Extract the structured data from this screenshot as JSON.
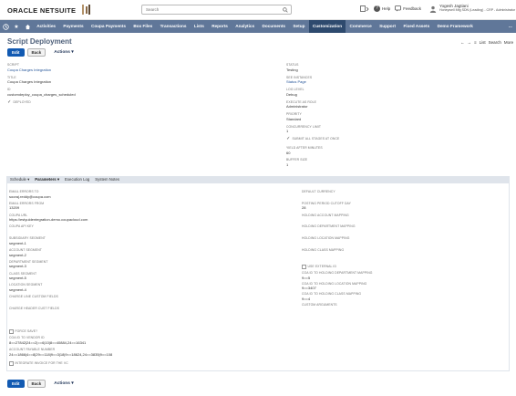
{
  "header": {
    "logo_text": "ORACLE NETSUITE",
    "search_placeholder": "Search",
    "help_label": "Help",
    "feedback_label": "Feedback",
    "user_name": "Yogesh Jagtiani",
    "user_role": "Honeywell Mfg SDN (Leading) - CRP - Administrator"
  },
  "nav": {
    "items": [
      "Activities",
      "Payments",
      "Coupa Payments",
      "Box Files",
      "Transactions",
      "Lists",
      "Reports",
      "Analytics",
      "Documents",
      "Setup",
      "Customization",
      "Commerce",
      "Support",
      "Fixed Assets",
      "Demo Framework"
    ],
    "active": "Customization",
    "more": "..."
  },
  "page": {
    "title": "Script Deployment",
    "list_label": "List",
    "search_label": "Search",
    "more_label": "More",
    "edit_label": "Edit",
    "back_label": "Back",
    "actions_label": "Actions ▾"
  },
  "primary_left": [
    {
      "label": "SCRIPT",
      "value": "Coupa Charges Integration",
      "link": true
    },
    {
      "label": "TITLE",
      "value": "Coupa Charges Integration"
    },
    {
      "label": "ID",
      "value": "customdeploy_coupa_charges_scheduled"
    }
  ],
  "deployed_label": "DEPLOYED",
  "primary_right": [
    {
      "label": "STATUS",
      "value": "Testing"
    },
    {
      "label": "SEE INSTANCES",
      "value": "Status Page",
      "link": true
    },
    {
      "label": "LOG LEVEL",
      "value": "Debug"
    },
    {
      "label": "EXECUTE AS ROLE",
      "value": "Administrator"
    },
    {
      "label": "PRIORITY",
      "value": "Standard"
    },
    {
      "label": "CONCURRENCY LIMIT",
      "value": "1"
    }
  ],
  "submit_all_label": "SUBMIT ALL STAGES AT ONCE",
  "primary_right_2": [
    {
      "label": "YIELD AFTER MINUTES",
      "value": "60"
    },
    {
      "label": "BUFFER SIZE",
      "value": "1"
    }
  ],
  "subtabs": [
    "Schedule ▾",
    "Parameters ▾",
    "Execution Log",
    "System Notes"
  ],
  "active_subtab": "Parameters ▾",
  "params_left": [
    {
      "label": "EMAIL ERRORS TO",
      "value": "sooraj.reddy@coupa.com"
    },
    {
      "label": "EMAIL ERRORS FROM",
      "value": "13209"
    },
    {
      "label": "COUPA URL",
      "value": "https://estyuldentegration-demo.coupacloud.com"
    },
    {
      "label": "COUPA API KEY",
      "value": ""
    },
    {
      "label": "SUBSIDIARY SEGMENT",
      "value": "segment-1"
    },
    {
      "label": "ACCOUNT SEGMENT",
      "value": "segment-2"
    },
    {
      "label": "DEPARTMENT SEGMENT",
      "value": "segment-3"
    },
    {
      "label": "CLASS SEGMENT",
      "value": "segment-5"
    },
    {
      "label": "LOCATION SEGMENT",
      "value": "segment-4"
    },
    {
      "label": "CHARGE LINE CUSTOM FIELDS",
      "value": ""
    },
    {
      "label": "CHARGE HEADER CUST FIELDS",
      "value": ""
    }
  ],
  "force_save_label": "FORCE SAVE?",
  "params_left_2": [
    {
      "label": "COA ID TO VENDOR ID",
      "value": "8==27842|24==2|==6|10|8==40884,24==16341"
    },
    {
      "label": "ACCOUNT PAYABLE NUMBER",
      "value": "24==1866|4==8|29==118|9==3|18|9==18624,24==3835|9==108"
    }
  ],
  "integrate_invoice_label": "INTEGRATE INVOICE FOR THE VC",
  "params_right": [
    {
      "label": "DEFAULT CURRENCY",
      "value": ""
    },
    {
      "label": "POSTING PERIOD CUTOFF DAY",
      "value": "28"
    },
    {
      "label": "HOLDING ACCOUNT MAPPING",
      "value": ""
    },
    {
      "label": "HOLDING DEPARTMENT MAPPING",
      "value": ""
    },
    {
      "label": "HOLDING LOCATION MAPPING",
      "value": ""
    },
    {
      "label": "HOLDING CLASS MAPPING",
      "value": ""
    }
  ],
  "use_external_label": "USE EXTERNAL ID",
  "params_right_2": [
    {
      "label": "COA ID TO HOLDING DEPARTMENT MAPPING",
      "value": "9==5"
    },
    {
      "label": "COA ID TO HOLDING LOCATION MAPPING",
      "value": "9==3407"
    },
    {
      "label": "COA ID TO HOLDING CLASS MAPPING",
      "value": "9==4"
    },
    {
      "label": "CUSTOM ARGUMENTS",
      "value": ""
    }
  ]
}
